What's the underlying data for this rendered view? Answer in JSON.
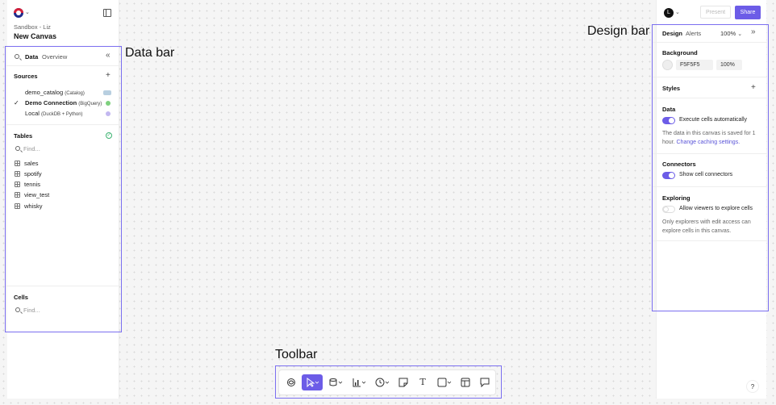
{
  "header": {
    "breadcrumb": "Sandbox - Liz",
    "canvas_title": "New Canvas"
  },
  "data_bar": {
    "tabs": [
      "Data",
      "Overview"
    ],
    "sources_title": "Sources",
    "sources": [
      {
        "name": "demo_catalog",
        "tag": "(Catalog)",
        "status_color": "#b8cfe0",
        "selected": false
      },
      {
        "name": "Demo Connection",
        "tag": "(BigQuery)",
        "status_color": "#7ed07e",
        "selected": true
      },
      {
        "name": "Local",
        "tag": "(DuckDB + Python)",
        "status_color": "#c3b8f0",
        "selected": false
      }
    ],
    "tables_title": "Tables",
    "tables_find_placeholder": "Find...",
    "tables": [
      "sales",
      "spotify",
      "tennis",
      "view_test",
      "whisky"
    ],
    "cells_title": "Cells",
    "cells_find_placeholder": "Find..."
  },
  "labels": {
    "data_bar": "Data bar",
    "design_bar": "Design bar",
    "toolbar": "Toolbar"
  },
  "top_right": {
    "avatar_initial": "L",
    "present_label": "Present",
    "share_label": "Share",
    "accent": "#6c5ce7"
  },
  "design_bar": {
    "tabs": [
      "Design",
      "Alerts"
    ],
    "zoom": "100%",
    "background_title": "Background",
    "background_color": "F5F5F5",
    "background_opacity": "100%",
    "styles_title": "Styles",
    "data_title": "Data",
    "execute_label": "Execute cells automatically",
    "execute_on": true,
    "cache_text": "The data in this canvas is saved for 1 hour.",
    "cache_link": "Change caching settings.",
    "connectors_title": "Connectors",
    "connectors_label": "Show cell connectors",
    "connectors_on": true,
    "exploring_title": "Exploring",
    "exploring_label": "Allow viewers to explore cells",
    "exploring_on": false,
    "exploring_text": "Only explorers with edit access can explore cells in this canvas."
  },
  "toolbar": {
    "tools": [
      "ai-icon",
      "pointer-icon",
      "database-icon",
      "chart-icon",
      "clock-icon",
      "sticky-note-icon",
      "text-icon",
      "shape-icon",
      "frame-icon",
      "comment-icon"
    ],
    "active_tool": "pointer-icon"
  },
  "help_label": "?"
}
